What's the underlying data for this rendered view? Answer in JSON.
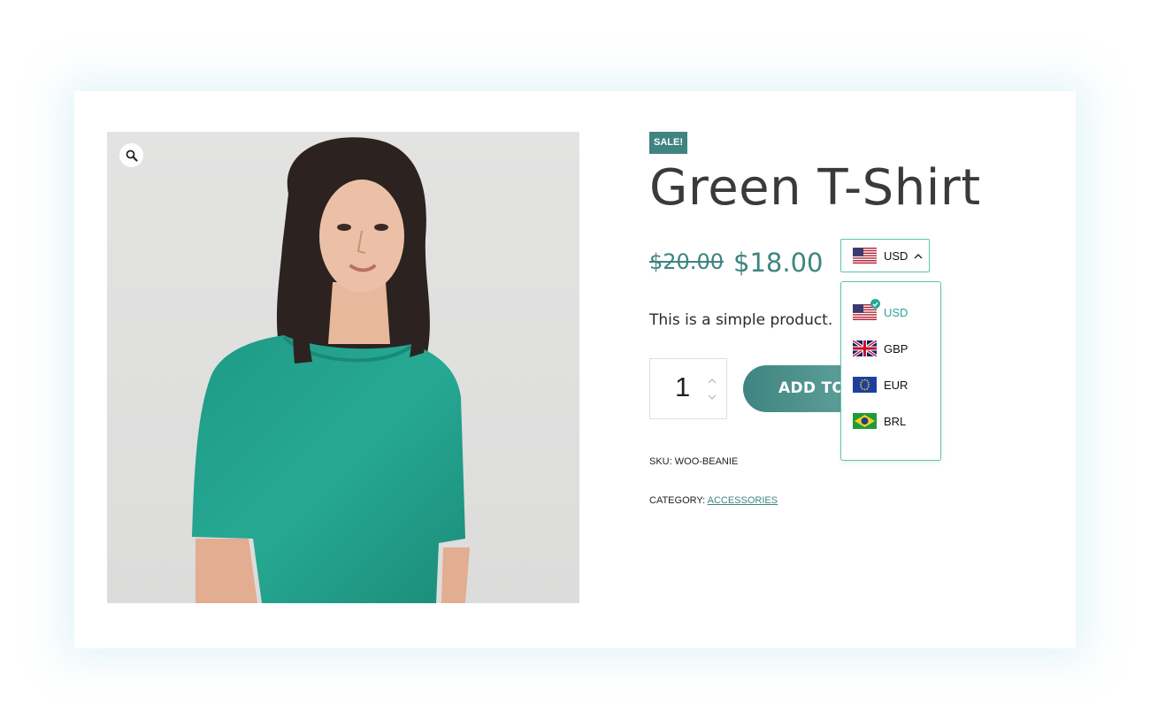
{
  "product": {
    "sale_badge": "SALE!",
    "title": "Green T-Shirt",
    "old_price": "$20.00",
    "price": "$18.00",
    "description": "This is a simple product.",
    "quantity": "1",
    "add_to_cart_label": "ADD TO CART",
    "sku_label": "SKU:",
    "sku": "WOO-BEANIE",
    "category_label": "CATEGORY:",
    "category": "ACCESSORIES"
  },
  "currency_switcher": {
    "selected": "USD",
    "options": [
      {
        "code": "USD",
        "flag": "us-flag-icon",
        "active": true
      },
      {
        "code": "GBP",
        "flag": "uk-flag-icon",
        "active": false
      },
      {
        "code": "EUR",
        "flag": "eu-flag-icon",
        "active": false
      },
      {
        "code": "BRL",
        "flag": "brazil-flag-icon",
        "active": false
      }
    ]
  },
  "image": {
    "icon": "zoom-icon"
  },
  "colors": {
    "accent": "#3f8480",
    "switcher_border": "#5cc4b2",
    "active_option": "#2aa597",
    "shirt": "#23a08d"
  }
}
